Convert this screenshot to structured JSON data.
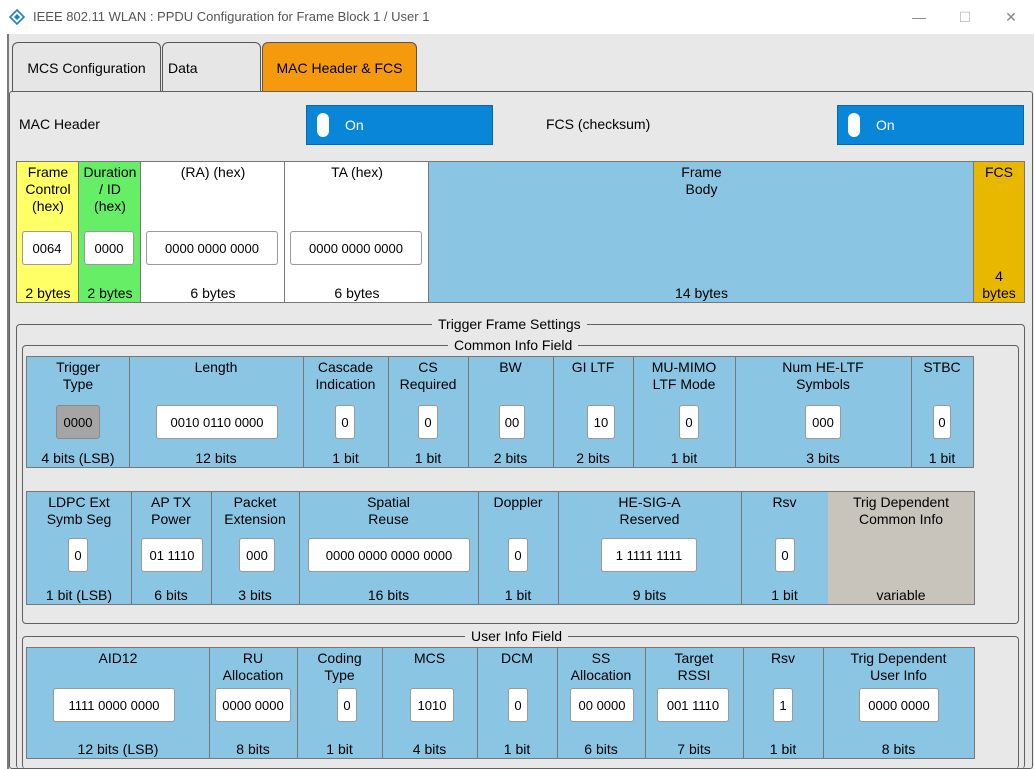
{
  "window": {
    "title": "IEEE 802.11 WLAN : PPDU Configuration for Frame Block 1 / User 1",
    "minimize": "—",
    "maximize": "☐",
    "close": "✕"
  },
  "tabs": [
    {
      "label": "MCS Configuration"
    },
    {
      "label": "Data"
    },
    {
      "label": "MAC Header & FCS",
      "active": true
    }
  ],
  "mac_header": {
    "label": "MAC Header",
    "toggle": "On"
  },
  "fcs": {
    "label": "FCS (checksum)",
    "toggle": "On"
  },
  "frame": {
    "frame_control": {
      "head": "Frame\nControl\n(hex)",
      "value": "0064",
      "size": "2 bytes"
    },
    "duration": {
      "head": "Duration\n/ ID\n(hex)",
      "value": "0000",
      "size": "2 bytes"
    },
    "ra": {
      "head": "(RA) (hex)",
      "value": "0000 0000 0000",
      "size": "6 bytes"
    },
    "ta": {
      "head": "TA (hex)",
      "value": "0000 0000 0000",
      "size": "6 bytes"
    },
    "body": {
      "head": "Frame\nBody",
      "size": "14 bytes"
    },
    "fcs": {
      "head": "FCS",
      "size": "4\nbytes"
    }
  },
  "trigger": {
    "legend": "Trigger Frame Settings",
    "common_legend": "Common Info Field",
    "row1": [
      {
        "head": "Trigger\nType",
        "value": "0000",
        "size": "4 bits (LSB)"
      },
      {
        "head": "Length",
        "value": "0010 0110 0000",
        "size": "12 bits"
      },
      {
        "head": "Cascade\nIndication",
        "value": "0",
        "size": "1 bit"
      },
      {
        "head": "CS\nRequired",
        "value": "0",
        "size": "1 bit"
      },
      {
        "head": "BW",
        "value": "00",
        "size": "2 bits"
      },
      {
        "head": "GI LTF",
        "value": "10",
        "size": "2 bits"
      },
      {
        "head": "MU-MIMO\nLTF Mode",
        "value": "0",
        "size": "1 bit"
      },
      {
        "head": "Num HE-LTF\nSymbols",
        "value": "000",
        "size": "3 bits"
      },
      {
        "head": "STBC",
        "value": "0",
        "size": "1 bit"
      }
    ],
    "row2": [
      {
        "head": "LDPC Ext\nSymb Seg",
        "value": "0",
        "size": "1 bit (LSB)"
      },
      {
        "head": "AP TX\nPower",
        "value": "01 1110",
        "size": "6 bits"
      },
      {
        "head": "Packet\nExtension",
        "value": "000",
        "size": "3 bits"
      },
      {
        "head": "Spatial\nReuse",
        "value": "0000 0000 0000 0000",
        "size": "16 bits"
      },
      {
        "head": "Doppler",
        "value": "0",
        "size": "1 bit"
      },
      {
        "head": "HE-SIG-A\nReserved",
        "value": "1 1111 1111",
        "size": "9 bits"
      },
      {
        "head": "Rsv",
        "value": "0",
        "size": "1 bit"
      },
      {
        "head": "Trig Dependent\nCommon Info",
        "size": "variable"
      }
    ],
    "user_legend": "User Info Field",
    "row3": [
      {
        "head": "AID12",
        "value": "1111 0000 0000",
        "size": "12 bits (LSB)"
      },
      {
        "head": "RU\nAllocation",
        "value": "0000 0000",
        "size": "8 bits"
      },
      {
        "head": "Coding\nType",
        "value": "0",
        "size": "1 bit"
      },
      {
        "head": "MCS",
        "value": "1010",
        "size": "4 bits"
      },
      {
        "head": "DCM",
        "value": "0",
        "size": "1 bit"
      },
      {
        "head": "SS\nAllocation",
        "value": "00 0000",
        "size": "6 bits"
      },
      {
        "head": "Target\nRSSI",
        "value": "001 1110",
        "size": "7 bits"
      },
      {
        "head": "Rsv",
        "value": "1",
        "size": "1 bit"
      },
      {
        "head": "Trig Dependent\nUser Info",
        "value": "0000 0000",
        "size": "8 bits"
      }
    ]
  },
  "colors": {
    "accent_tab": "#f59a0c",
    "toggle_blue": "#0a86d8",
    "field_blue": "#8ac5e4",
    "frame_control": "#ffff66",
    "duration": "#66ee66",
    "fcs": "#e8b800",
    "trig_dependent": "#c8c4bc"
  }
}
